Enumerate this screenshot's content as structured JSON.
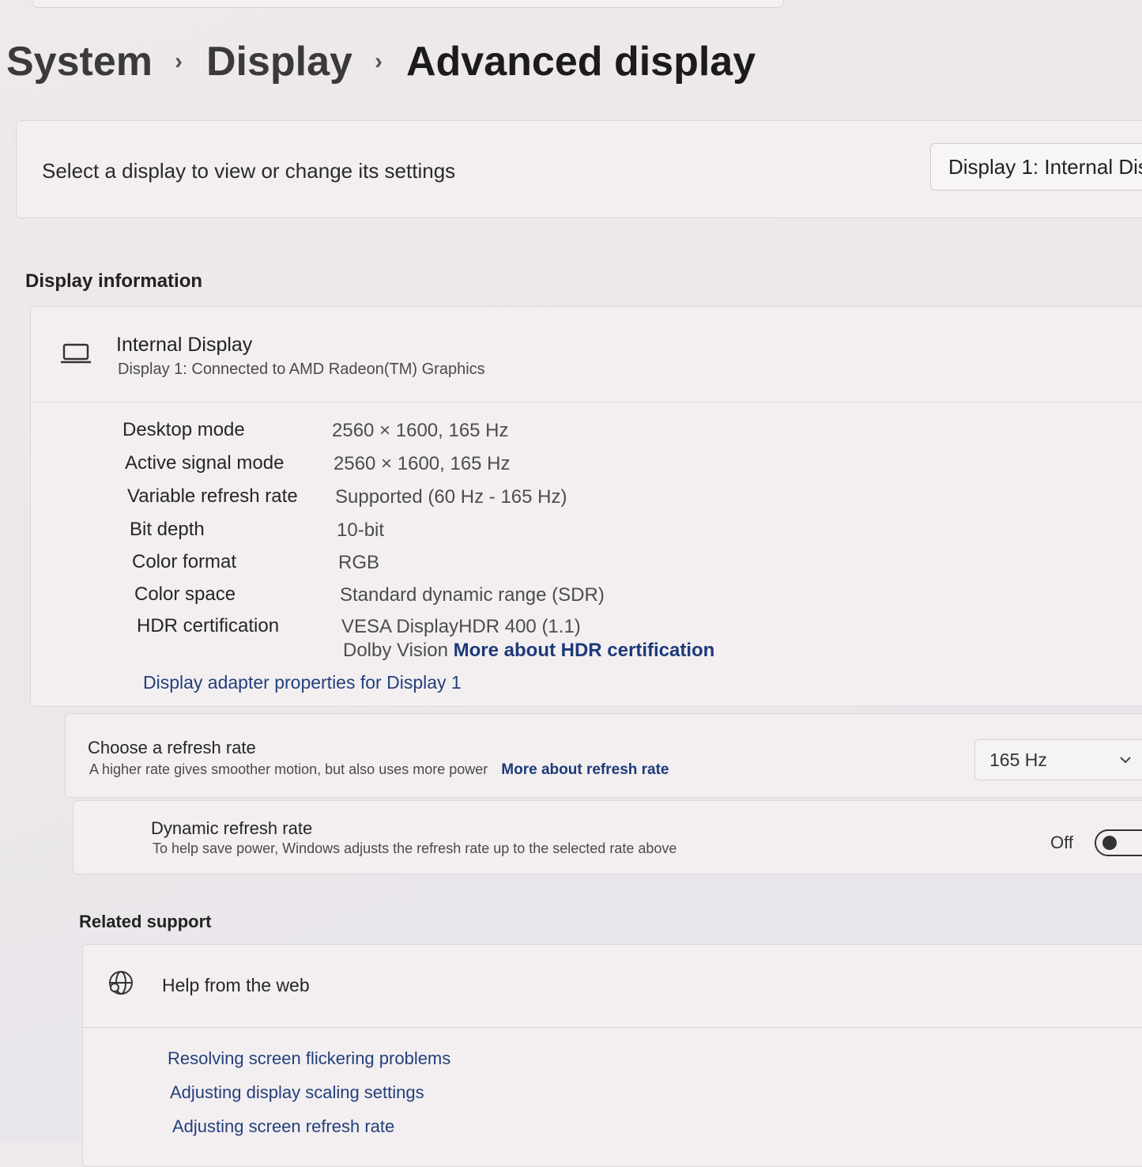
{
  "breadcrumb": {
    "items": [
      "System",
      "Display",
      "Advanced display"
    ],
    "separator": "›"
  },
  "display_select": {
    "label": "Select a display to view or change its settings",
    "selected": "Display 1: Internal Dis"
  },
  "display_info": {
    "section_title": "Display information",
    "name": "Internal Display",
    "subtitle": "Display 1: Connected to AMD Radeon(TM) Graphics",
    "rows": [
      {
        "label": "Desktop mode",
        "value": "2560 × 1600, 165 Hz"
      },
      {
        "label": "Active signal mode",
        "value": "2560 × 1600, 165 Hz"
      },
      {
        "label": "Variable refresh rate",
        "value": "Supported (60 Hz - 165 Hz)"
      },
      {
        "label": "Bit depth",
        "value": "10-bit"
      },
      {
        "label": "Color format",
        "value": "RGB"
      },
      {
        "label": "Color space",
        "value": "Standard dynamic range (SDR)"
      },
      {
        "label": "HDR certification",
        "value": "VESA DisplayHDR 400 (1.1)"
      }
    ],
    "hdr_extra": "Dolby Vision",
    "hdr_link": "More about HDR certification",
    "adapter_link": "Display adapter properties for Display 1"
  },
  "refresh_rate": {
    "title": "Choose a refresh rate",
    "subtitle": "A higher rate gives smoother motion, but also uses more power",
    "link": "More about refresh rate",
    "selected": "165 Hz"
  },
  "dynamic_refresh": {
    "title": "Dynamic refresh rate",
    "subtitle": "To help save power, Windows adjusts the refresh rate up to the selected rate above",
    "state": "Off",
    "enabled": false
  },
  "related_support": {
    "section_title": "Related support",
    "header": "Help from the web",
    "links": [
      "Resolving screen flickering problems",
      "Adjusting display scaling settings",
      "Adjusting screen refresh rate"
    ]
  },
  "colors": {
    "link": "#23407c",
    "card": "#f3eff1"
  }
}
